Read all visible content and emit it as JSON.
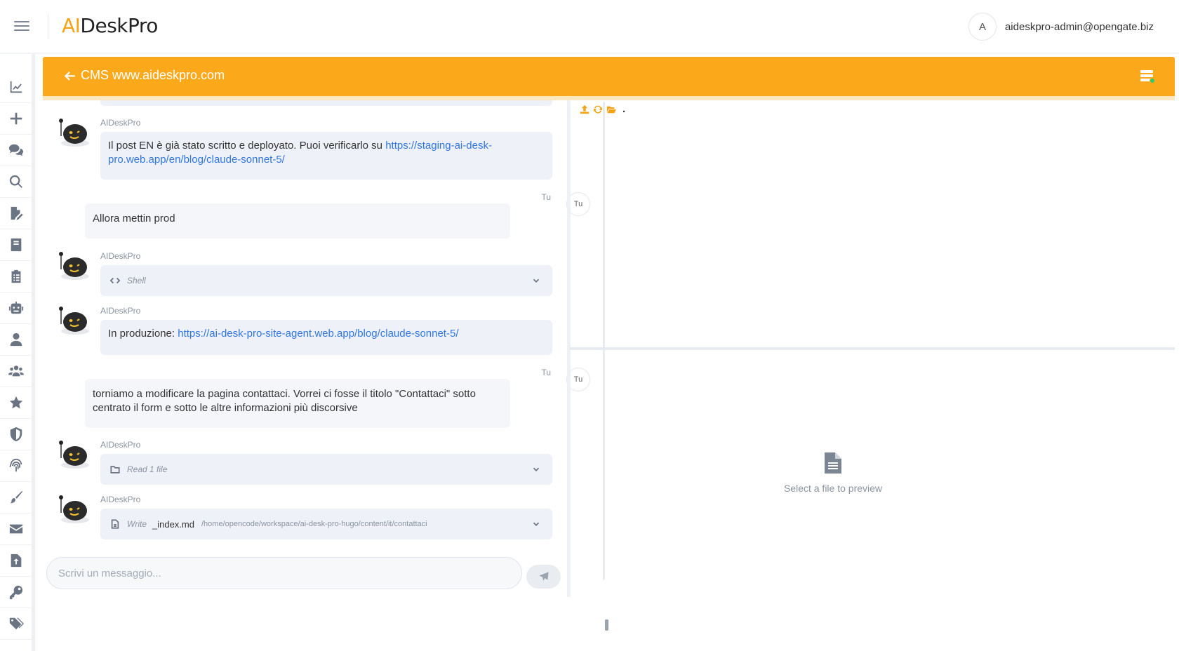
{
  "app": {
    "logo_ai": "AI",
    "logo_rest": "DeskPro",
    "user_initial": "A",
    "user_email": "aideskpro-admin@opengate.biz"
  },
  "sidebar": {
    "items": [
      {
        "icon": "chart-line-icon"
      },
      {
        "icon": "plus-icon"
      },
      {
        "icon": "comments-icon"
      },
      {
        "icon": "search-icon"
      },
      {
        "icon": "file-edit-icon"
      },
      {
        "icon": "book-icon"
      },
      {
        "icon": "clipboard-icon"
      },
      {
        "icon": "robot-icon"
      },
      {
        "icon": "user-icon"
      },
      {
        "icon": "users-icon"
      },
      {
        "icon": "star-icon"
      },
      {
        "icon": "shield-icon"
      },
      {
        "icon": "fingerprint-icon"
      },
      {
        "icon": "brush-icon"
      },
      {
        "icon": "envelope-icon"
      },
      {
        "icon": "file-upload-icon"
      },
      {
        "icon": "key-icon"
      },
      {
        "icon": "tags-icon"
      }
    ]
  },
  "header": {
    "title": "CMS www.aideskpro.com"
  },
  "chat": {
    "messages": [
      {
        "sender": "AIDeskPro",
        "text_before": "Il post EN è già stato scritto e deployato. Puoi verificarlo su ",
        "link": "https://staging-ai-desk-pro.web.app/en/blog/claude-sonnet-5/"
      },
      {
        "sender": "Tu",
        "avatar": "Tu",
        "text": "Allora mettin prod"
      },
      {
        "sender": "AIDeskPro",
        "tool": "Shell"
      },
      {
        "sender": "AIDeskPro",
        "text_before": "In produzione: ",
        "link": "https://ai-desk-pro-site-agent.web.app/blog/claude-sonnet-5/"
      },
      {
        "sender": "Tu",
        "avatar": "Tu",
        "text": "torniamo a modificare la pagina contattaci. Vorrei ci fosse il titolo \"Contattaci\" sotto centrato il form e sotto le altre informazioni più discorsive"
      },
      {
        "sender": "AIDeskPro",
        "tool": "Read 1 file"
      },
      {
        "sender": "AIDeskPro",
        "tool": "Write",
        "file": "_index.md",
        "path": "/home/opencode/workspace/ai-desk-pro-hugo/content/it/contattaci"
      }
    ],
    "input_placeholder": "Scrivi un messaggio..."
  },
  "files": {
    "current_path": ".",
    "preview_empty": "Select a file to preview"
  },
  "colors": {
    "accent": "#fba81a",
    "link": "#2f76e0",
    "bubble_bot": "#eef1f7",
    "bubble_user": "#f4f6fa"
  }
}
